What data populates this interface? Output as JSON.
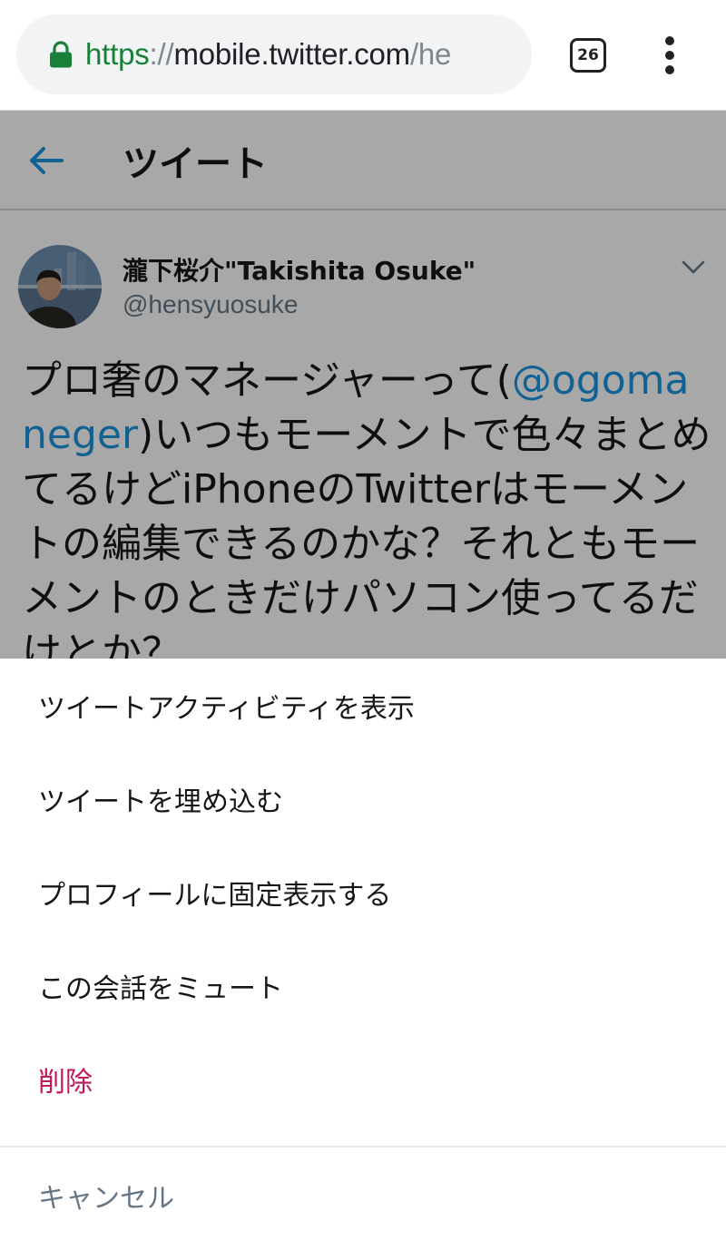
{
  "browser": {
    "url_scheme": "https",
    "url_separator": "://",
    "url_host": "mobile.twitter.com",
    "url_path": "/he",
    "tab_count": "26",
    "secure_icon": "lock-icon",
    "menu_icon": "more-vert-icon"
  },
  "header": {
    "back_icon": "arrow-left-icon",
    "title": "ツイート"
  },
  "tweet": {
    "display_name": "瀧下桜介\"Takishita Osuke\"",
    "handle": "@hensyuosuke",
    "text_before_mention": "プロ奢のマネージャーって(",
    "mention": "@ogomaneger",
    "text_after_mention": ")いつもモーメントで色々まとめてるけどiPhoneのTwitterはモーメントの編集できるのかな？それともモーメントのときだけパソコン使ってるだけとか？"
  },
  "sheet": {
    "items": [
      {
        "label": "ツイートアクティビティを表示"
      },
      {
        "label": "ツイートを埋め込む"
      },
      {
        "label": "プロフィールに固定表示する"
      },
      {
        "label": "この会話をミュート"
      },
      {
        "label": "削除"
      }
    ],
    "cancel_label": "キャンセル"
  },
  "colors": {
    "link_blue": "#1b95e0",
    "delete_red": "#c2185b",
    "secure_green": "#188038",
    "muted_gray": "#657786"
  }
}
